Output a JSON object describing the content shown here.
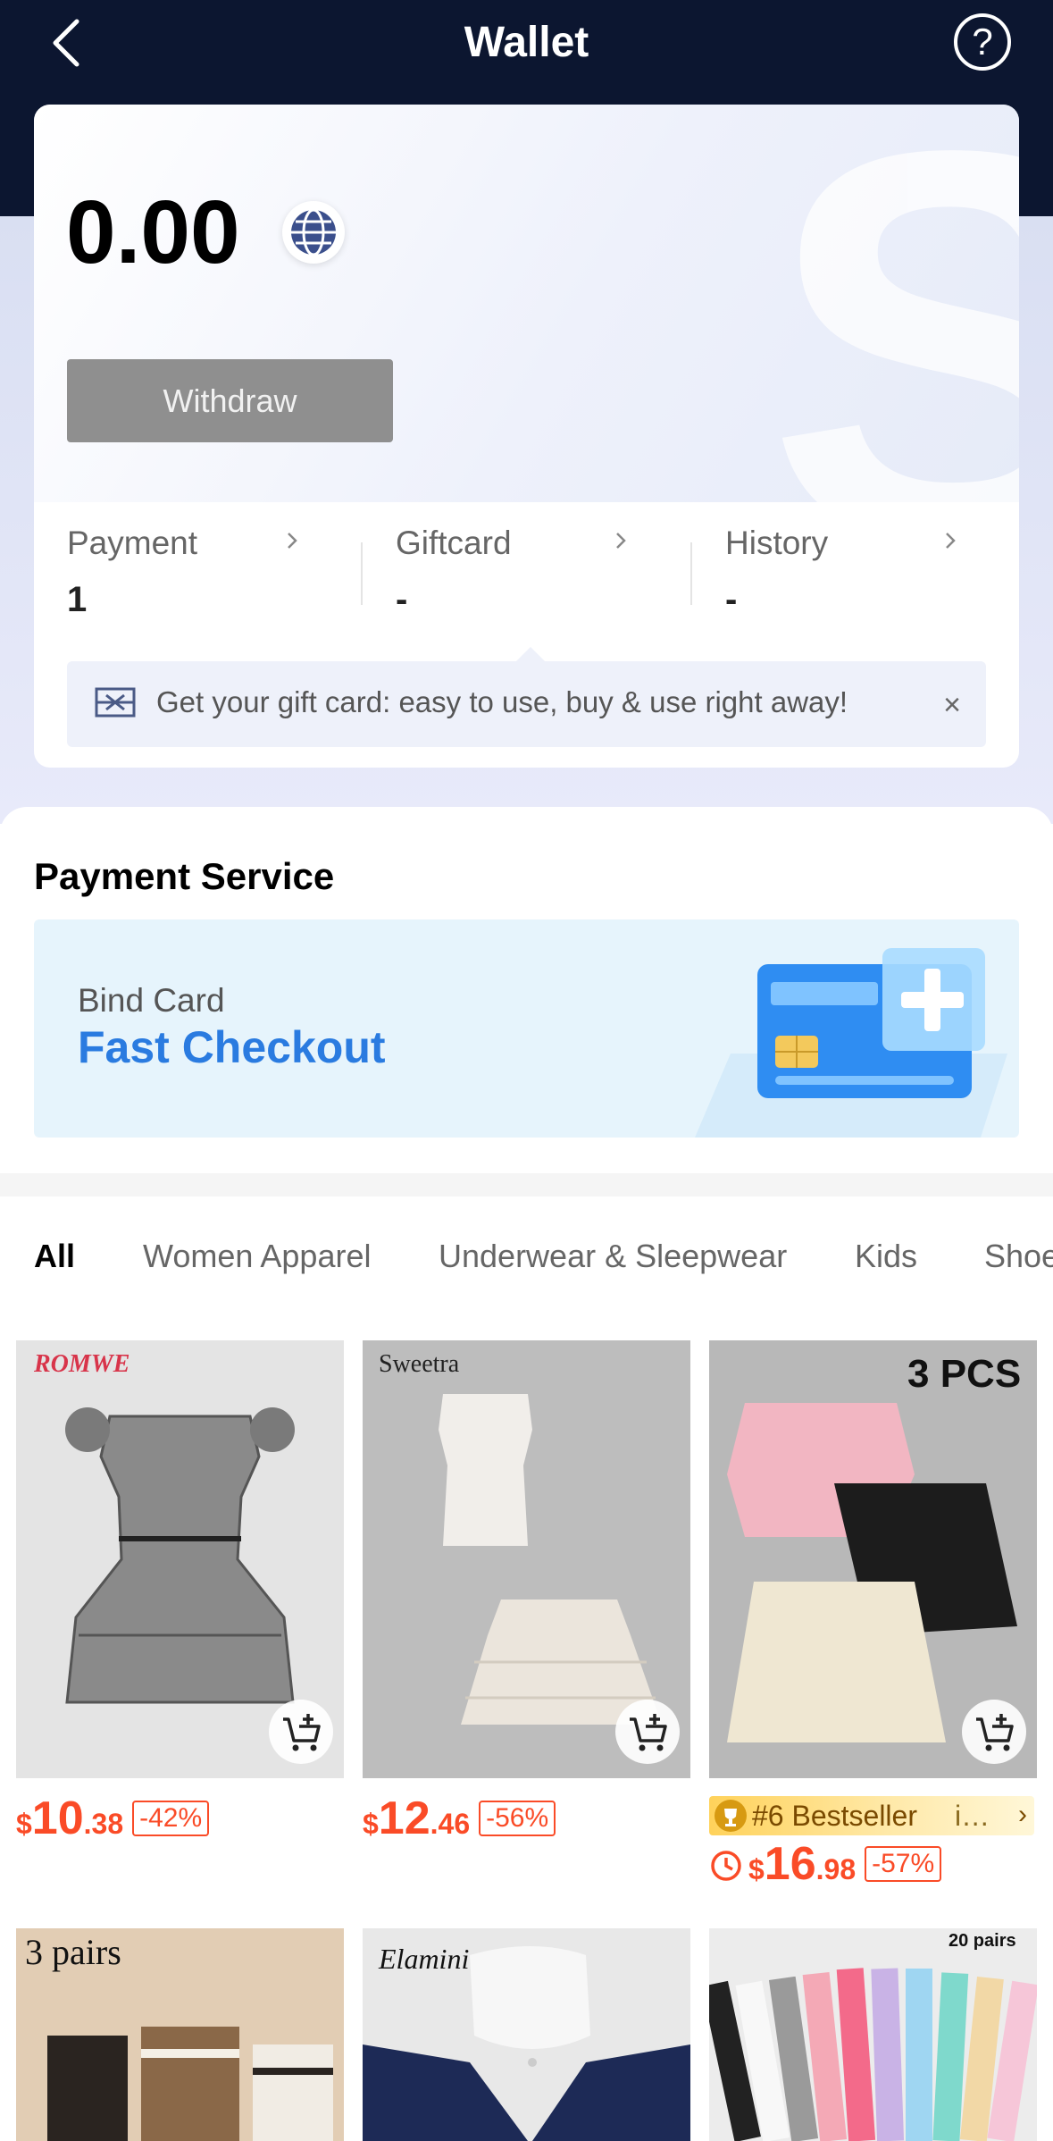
{
  "header": {
    "title": "Wallet"
  },
  "wallet": {
    "balance": "0.00",
    "withdraw_label": "Withdraw",
    "stats": [
      {
        "label": "Payment",
        "value": "1"
      },
      {
        "label": "Giftcard",
        "value": "-"
      },
      {
        "label": "History",
        "value": "-"
      }
    ],
    "tip": {
      "text": "Get your gift card: easy to use, buy & use right away!",
      "close": "×"
    }
  },
  "payment_service": {
    "title": "Payment Service",
    "bind_small": "Bind Card",
    "bind_big": "Fast Checkout"
  },
  "categories": [
    "All",
    "Women Apparel",
    "Underwear & Sleepwear",
    "Kids",
    "Shoe"
  ],
  "products": [
    {
      "brand": "ROMWE",
      "currency": "$",
      "price_int": "10",
      "price_dec": ".38",
      "discount": "-42%"
    },
    {
      "brand": "Sweetra",
      "currency": "$",
      "price_int": "12",
      "price_dec": ".46",
      "discount": "-56%"
    },
    {
      "brand": "",
      "overlay": "3 PCS",
      "currency": "$",
      "price_int": "16",
      "price_dec": ".98",
      "discount": "-57%",
      "badge": "#6 Bestseller",
      "badge_more": "i…"
    },
    {
      "overlay": "3 pairs"
    },
    {
      "brand": "Elamini"
    },
    {
      "overlay": "20 pairs"
    }
  ],
  "colors": {
    "header_bg": "#0c1630",
    "price": "#fa4b27",
    "accent_blue": "#2a7be0",
    "withdraw_bg": "#8f8f8f"
  },
  "icons": {
    "back": "chevron-left-icon",
    "help": "question-circle-icon",
    "globe": "globe-icon",
    "ticket": "ticket-icon",
    "cart": "add-to-cart-icon",
    "trophy": "trophy-icon",
    "clock": "clock-icon"
  }
}
